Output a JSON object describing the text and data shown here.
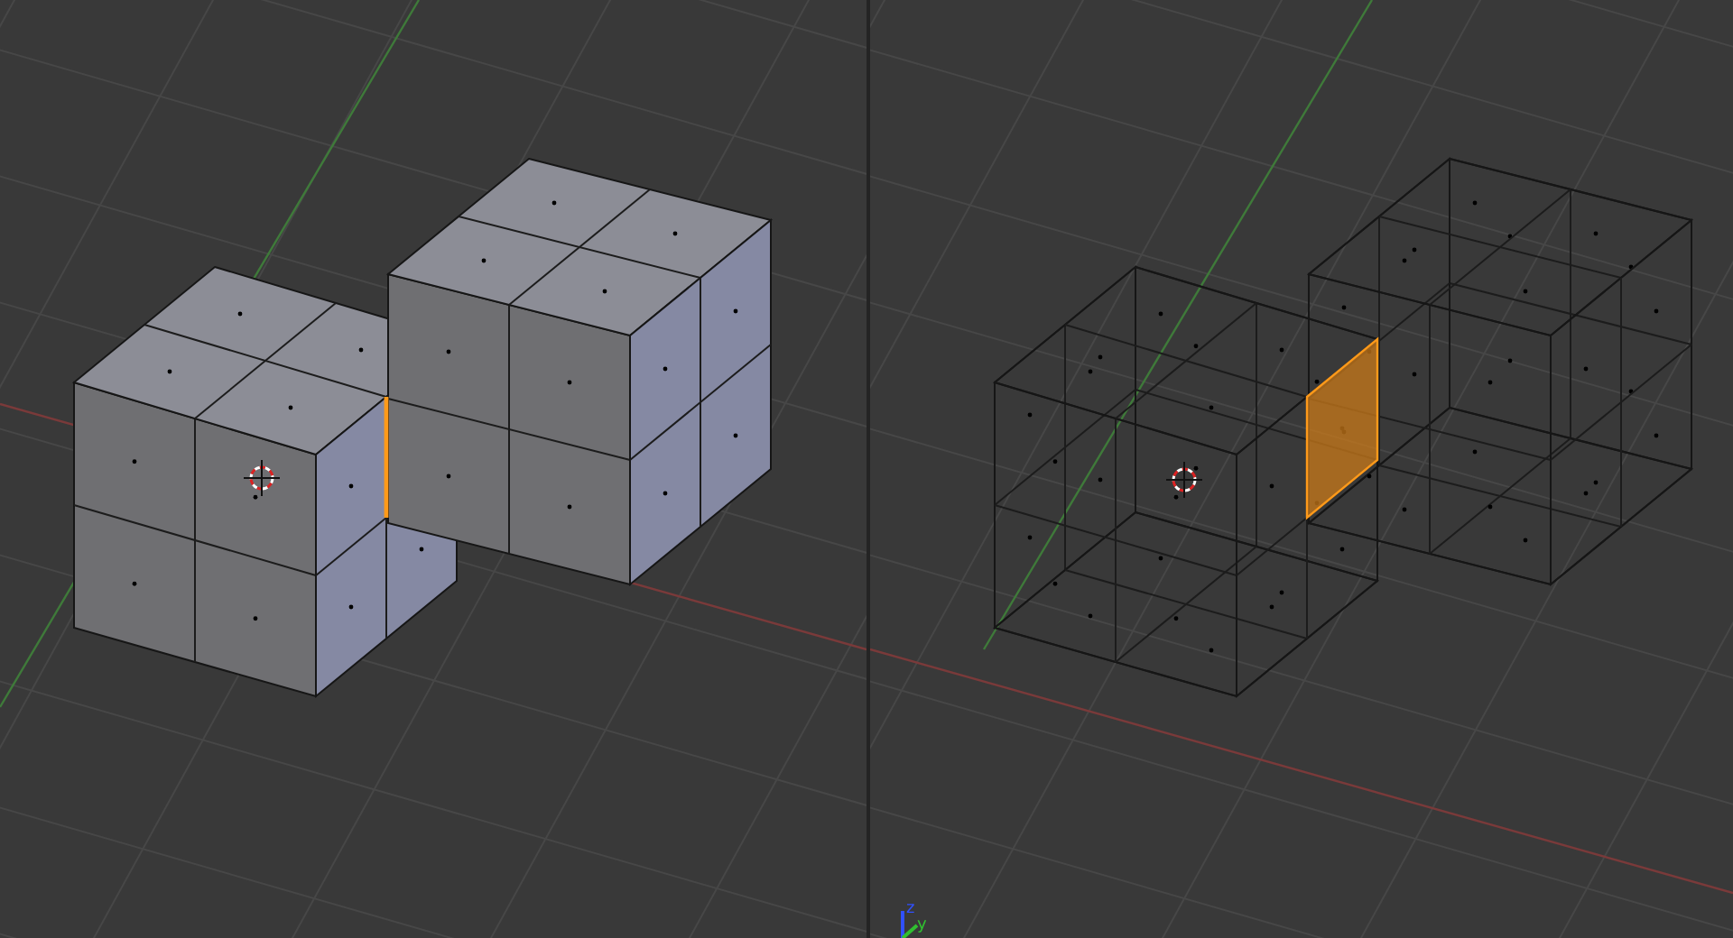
{
  "viewports": [
    {
      "wireframe": false,
      "edge_selected": true,
      "face_selected": false
    },
    {
      "wireframe": true,
      "edge_selected": false,
      "face_selected": true,
      "axis_labels": [
        "z",
        "y"
      ]
    }
  ]
}
